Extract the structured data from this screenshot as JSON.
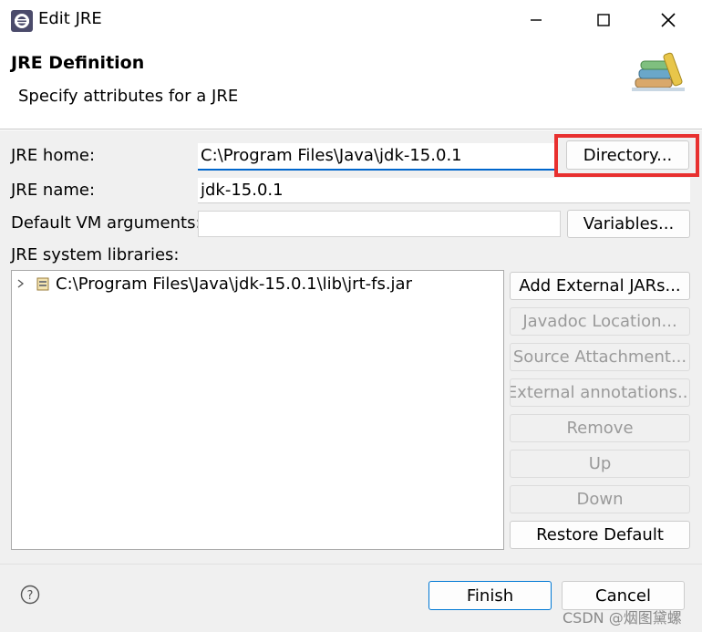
{
  "window": {
    "title": "Edit JRE",
    "minimize_icon": "minimize-icon",
    "maximize_icon": "maximize-icon",
    "close_icon": "close-icon"
  },
  "header": {
    "title": "JRE Definition",
    "subtitle": "Specify attributes for a JRE"
  },
  "form": {
    "jre_home_label": "JRE home:",
    "jre_home_value": "C:\\Program Files\\Java\\jdk-15.0.1",
    "directory_button": "Directory...",
    "jre_name_label": "JRE name:",
    "jre_name_value": "jdk-15.0.1",
    "vm_args_label": "Default VM arguments:",
    "vm_args_value": "",
    "variables_button": "Variables...",
    "libraries_label": "JRE system libraries:"
  },
  "libraries": [
    {
      "path": "C:\\Program Files\\Java\\jdk-15.0.1\\lib\\jrt-fs.jar"
    }
  ],
  "library_buttons": {
    "add_external_jars": "Add External JARs...",
    "javadoc_location": "Javadoc Location...",
    "source_attachment": "Source Attachment...",
    "external_annotations": "External annotations...",
    "remove": "Remove",
    "up": "Up",
    "down": "Down",
    "restore_default": "Restore Default"
  },
  "footer": {
    "help_icon": "help-icon",
    "finish": "Finish",
    "cancel": "Cancel",
    "watermark": "CSDN @烟图黛螺"
  },
  "colors": {
    "accent": "#0078d4",
    "highlight": "#e8302f"
  }
}
